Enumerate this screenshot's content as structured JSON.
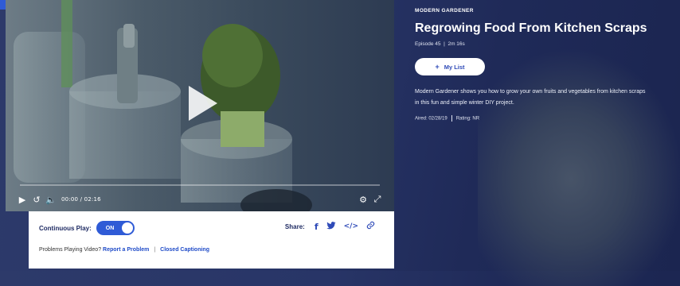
{
  "video": {
    "time_display": "00:00 / 02:16",
    "progress": 0
  },
  "panel": {
    "continuous_play_label": "Continuous Play:",
    "toggle_text": "ON",
    "share_label": "Share:",
    "problems_prefix": "Problems Playing Video?",
    "report_link": "Report a Problem",
    "cc_link": "Closed Captioning"
  },
  "icons": {
    "facebook": "f",
    "twitter": "twitter-bird",
    "embed": "</>",
    "link": "link-chain"
  },
  "info": {
    "show_name": "MODERN GARDENER",
    "title": "Regrowing Food From Kitchen Scraps",
    "episode": "Episode 45",
    "duration": "2m 16s",
    "mylist_label": "My List",
    "description": "Modern Gardener shows you how to grow your own fruits and vegetables from kitchen scraps in this fun and simple winter DIY project.",
    "aired": "Aired: 02/28/19",
    "rating": "Rating: NR"
  },
  "colors": {
    "accent": "#2f5bd6",
    "background": "#283567",
    "panel": "#ffffff",
    "link": "#1f4bc8"
  }
}
